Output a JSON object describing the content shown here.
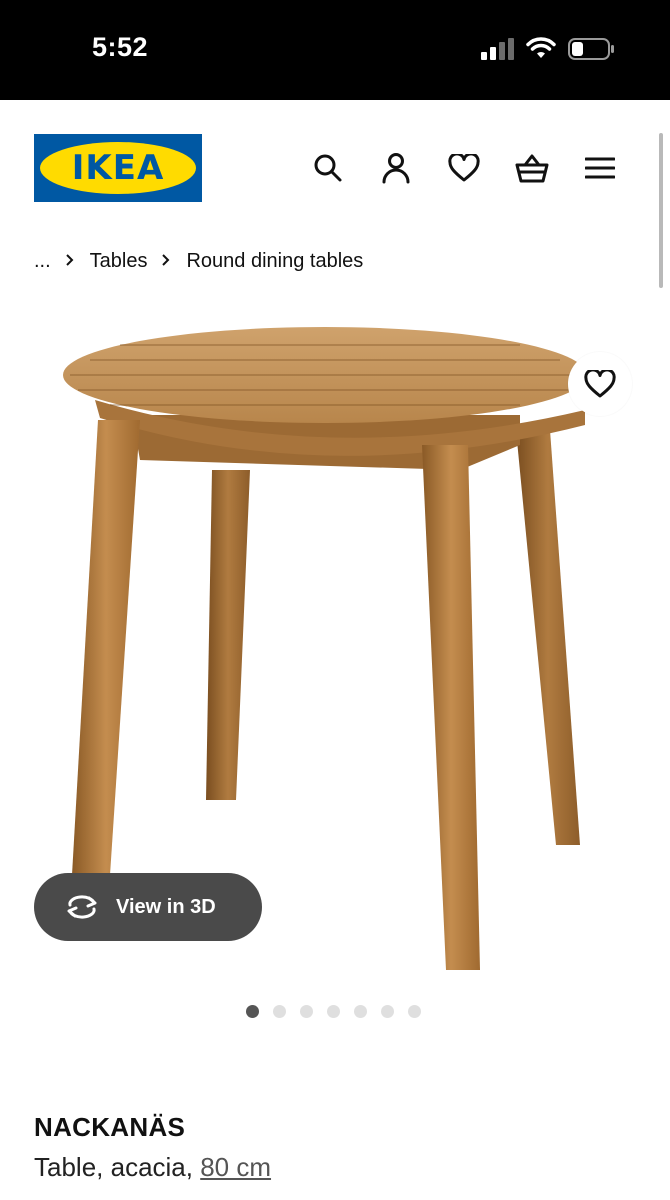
{
  "status": {
    "time": "5:52"
  },
  "header": {
    "logo_text": "IKEA"
  },
  "breadcrumb": {
    "ellipsis": "...",
    "items": [
      "Tables",
      "Round dining tables"
    ]
  },
  "gallery": {
    "view3d_label": "View in 3D",
    "dot_count": 7,
    "active_index": 0
  },
  "product": {
    "name": "NACKANÄS",
    "description": "Table, acacia, ",
    "size": "80 cm"
  },
  "colors": {
    "ikea_blue": "#0058a3",
    "ikea_yellow": "#ffdb00",
    "button_dark": "#4a4a4a"
  }
}
